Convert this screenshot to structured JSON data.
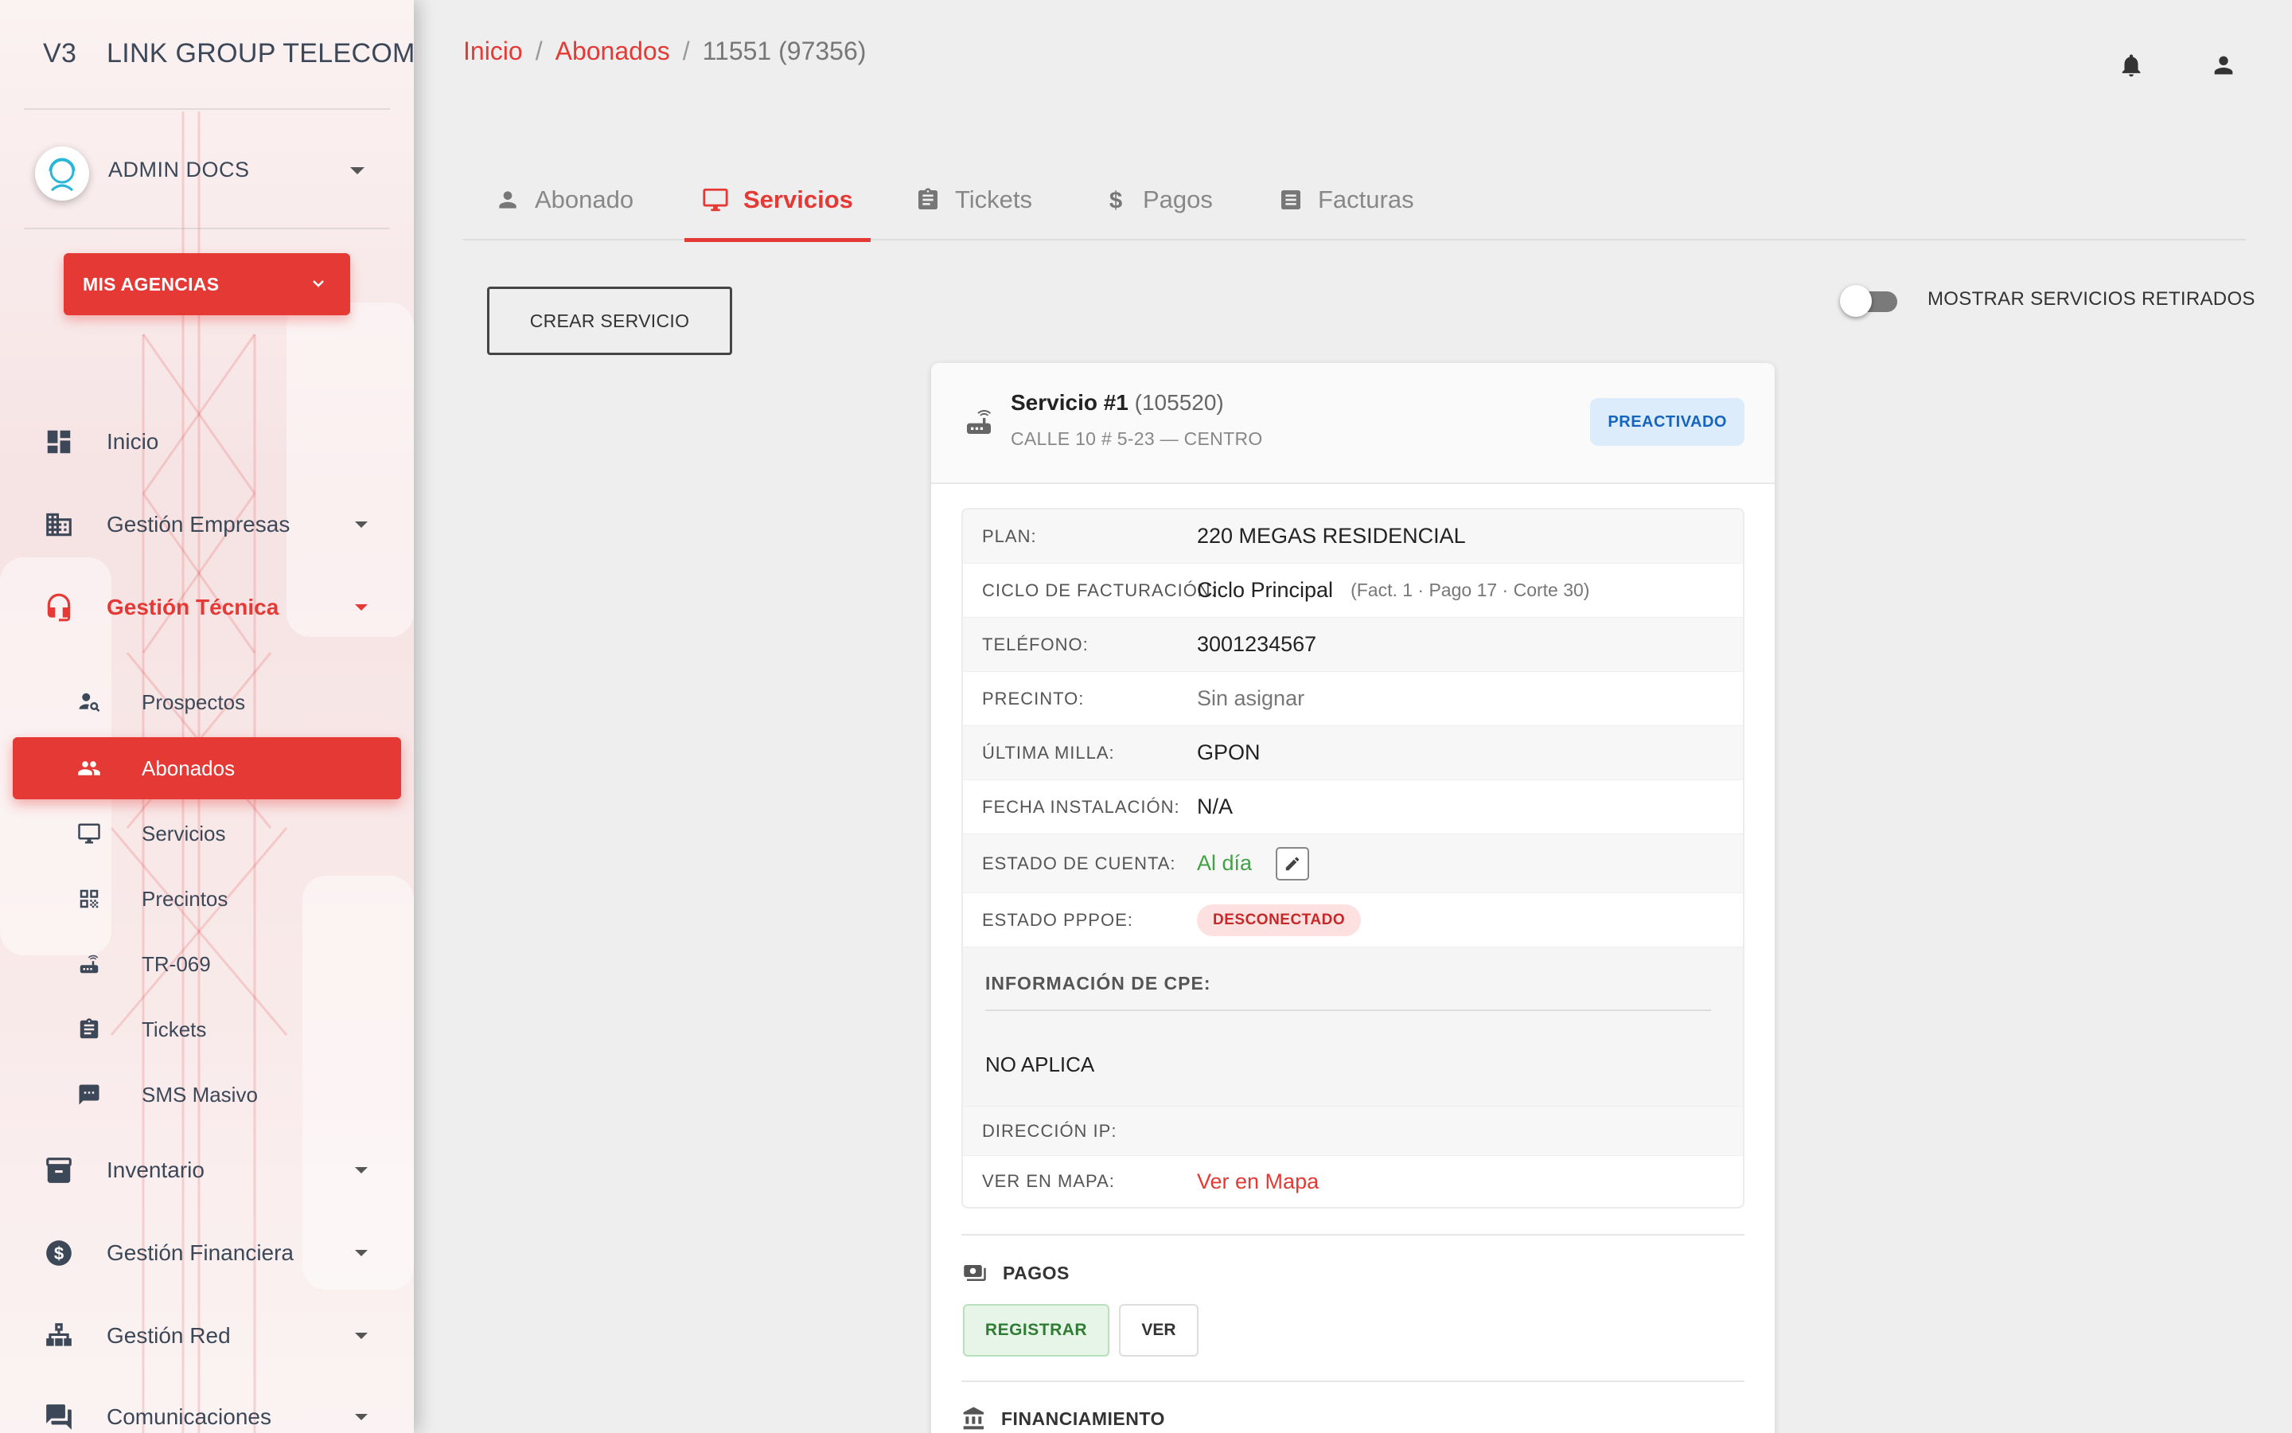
{
  "sidebar": {
    "brand_mini": "V3",
    "brand_name": "LINK GROUP TELECOMU",
    "user_name": "ADMIN DOCS",
    "agencies_button": "MIS AGENCIAS",
    "nav": {
      "inicio": "Inicio",
      "empresas": "Gestión Empresas",
      "tecnica": "Gestión Técnica",
      "inventario": "Inventario",
      "financiera": "Gestión Financiera",
      "red": "Gestión Red",
      "comunicaciones": "Comunicaciones"
    },
    "sub": {
      "prospectos": "Prospectos",
      "abonados": "Abonados",
      "servicios": "Servicios",
      "precintos": "Precintos",
      "tr069": "TR-069",
      "tickets": "Tickets",
      "sms": "SMS Masivo"
    }
  },
  "breadcrumb": {
    "home": "Inicio",
    "section": "Abonados",
    "current": "11551 (97356)",
    "separator": "/"
  },
  "tabs": {
    "abonado": "Abonado",
    "servicios": "Servicios",
    "tickets": "Tickets",
    "pagos": "Pagos",
    "facturas": "Facturas",
    "active": "Servicios"
  },
  "actions": {
    "create_service": "CREAR SERVICIO",
    "show_retired_label": "MOSTRAR SERVICIOS RETIRADOS",
    "show_retired_on": false
  },
  "service": {
    "title": "Servicio #1",
    "id": "(105520)",
    "address": "CALLE 10 # 5-23 — CENTRO",
    "status": "PREACTIVADO",
    "fields": {
      "plan_label": "PLAN:",
      "plan_value": "220 MEGAS RESIDENCIAL",
      "ciclo_label": "CICLO DE FACTURACIÓN:",
      "ciclo_value": "Ciclo Principal",
      "ciclo_extra": "(Fact. 1 · Pago 17 · Corte 30)",
      "telefono_label": "TELÉFONO:",
      "telefono_value": "3001234567",
      "precinto_label": "PRECINTO:",
      "precinto_value": "Sin asignar",
      "milla_label": "ÚLTIMA MILLA:",
      "milla_value": "GPON",
      "fecha_label": "FECHA INSTALACIÓN:",
      "fecha_value": "N/A",
      "cuenta_label": "ESTADO DE CUENTA:",
      "cuenta_value": "Al día",
      "pppoe_label": "ESTADO PPPOE:",
      "pppoe_value": "DESCONECTADO",
      "cpe_label": "INFORMACIÓN DE CPE:",
      "cpe_value": "NO APLICA",
      "ip_label": "DIRECCIÓN IP:",
      "ip_value": "",
      "mapa_label": "VER EN MAPA:",
      "mapa_value": "Ver en Mapa"
    },
    "pagos_title": "PAGOS",
    "pagos_register": "REGISTRAR",
    "pagos_view": "VER",
    "financiamiento_title": "FINANCIAMIENTO"
  },
  "colors": {
    "accent": "#e53935",
    "success": "#43a047",
    "info_badge": "#1565c0"
  }
}
